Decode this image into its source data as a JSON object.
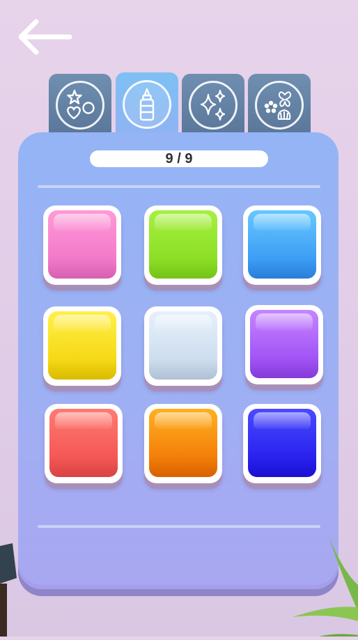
{
  "counter": {
    "text": "9 / 9"
  },
  "tabs": [
    {
      "id": "shapes",
      "icon": "shapes-icon",
      "active": false
    },
    {
      "id": "glue",
      "icon": "glue-bottle-icon",
      "active": true
    },
    {
      "id": "sparkles",
      "icon": "sparkles-icon",
      "active": false
    },
    {
      "id": "stickers",
      "icon": "butterfly-flower-shell-icon",
      "active": false
    }
  ],
  "colors": [
    {
      "name": "pink",
      "top": "#ff9ad8",
      "bottom": "#ee6cc4"
    },
    {
      "name": "lime",
      "top": "#a6f040",
      "bottom": "#82d81a"
    },
    {
      "name": "sky-blue",
      "top": "#66c8ff",
      "bottom": "#2d8cf0"
    },
    {
      "name": "yellow",
      "top": "#fff04a",
      "bottom": "#f2cf00"
    },
    {
      "name": "pale-blue",
      "top": "#e6f0fb",
      "bottom": "#c3d6ea"
    },
    {
      "name": "purple",
      "top": "#c585ff",
      "bottom": "#9440f0"
    },
    {
      "name": "red",
      "top": "#ff7a72",
      "bottom": "#f04a4a"
    },
    {
      "name": "orange",
      "top": "#ffb020",
      "bottom": "#ef6c00"
    },
    {
      "name": "blue",
      "top": "#4a4aff",
      "bottom": "#1c12e8"
    }
  ]
}
